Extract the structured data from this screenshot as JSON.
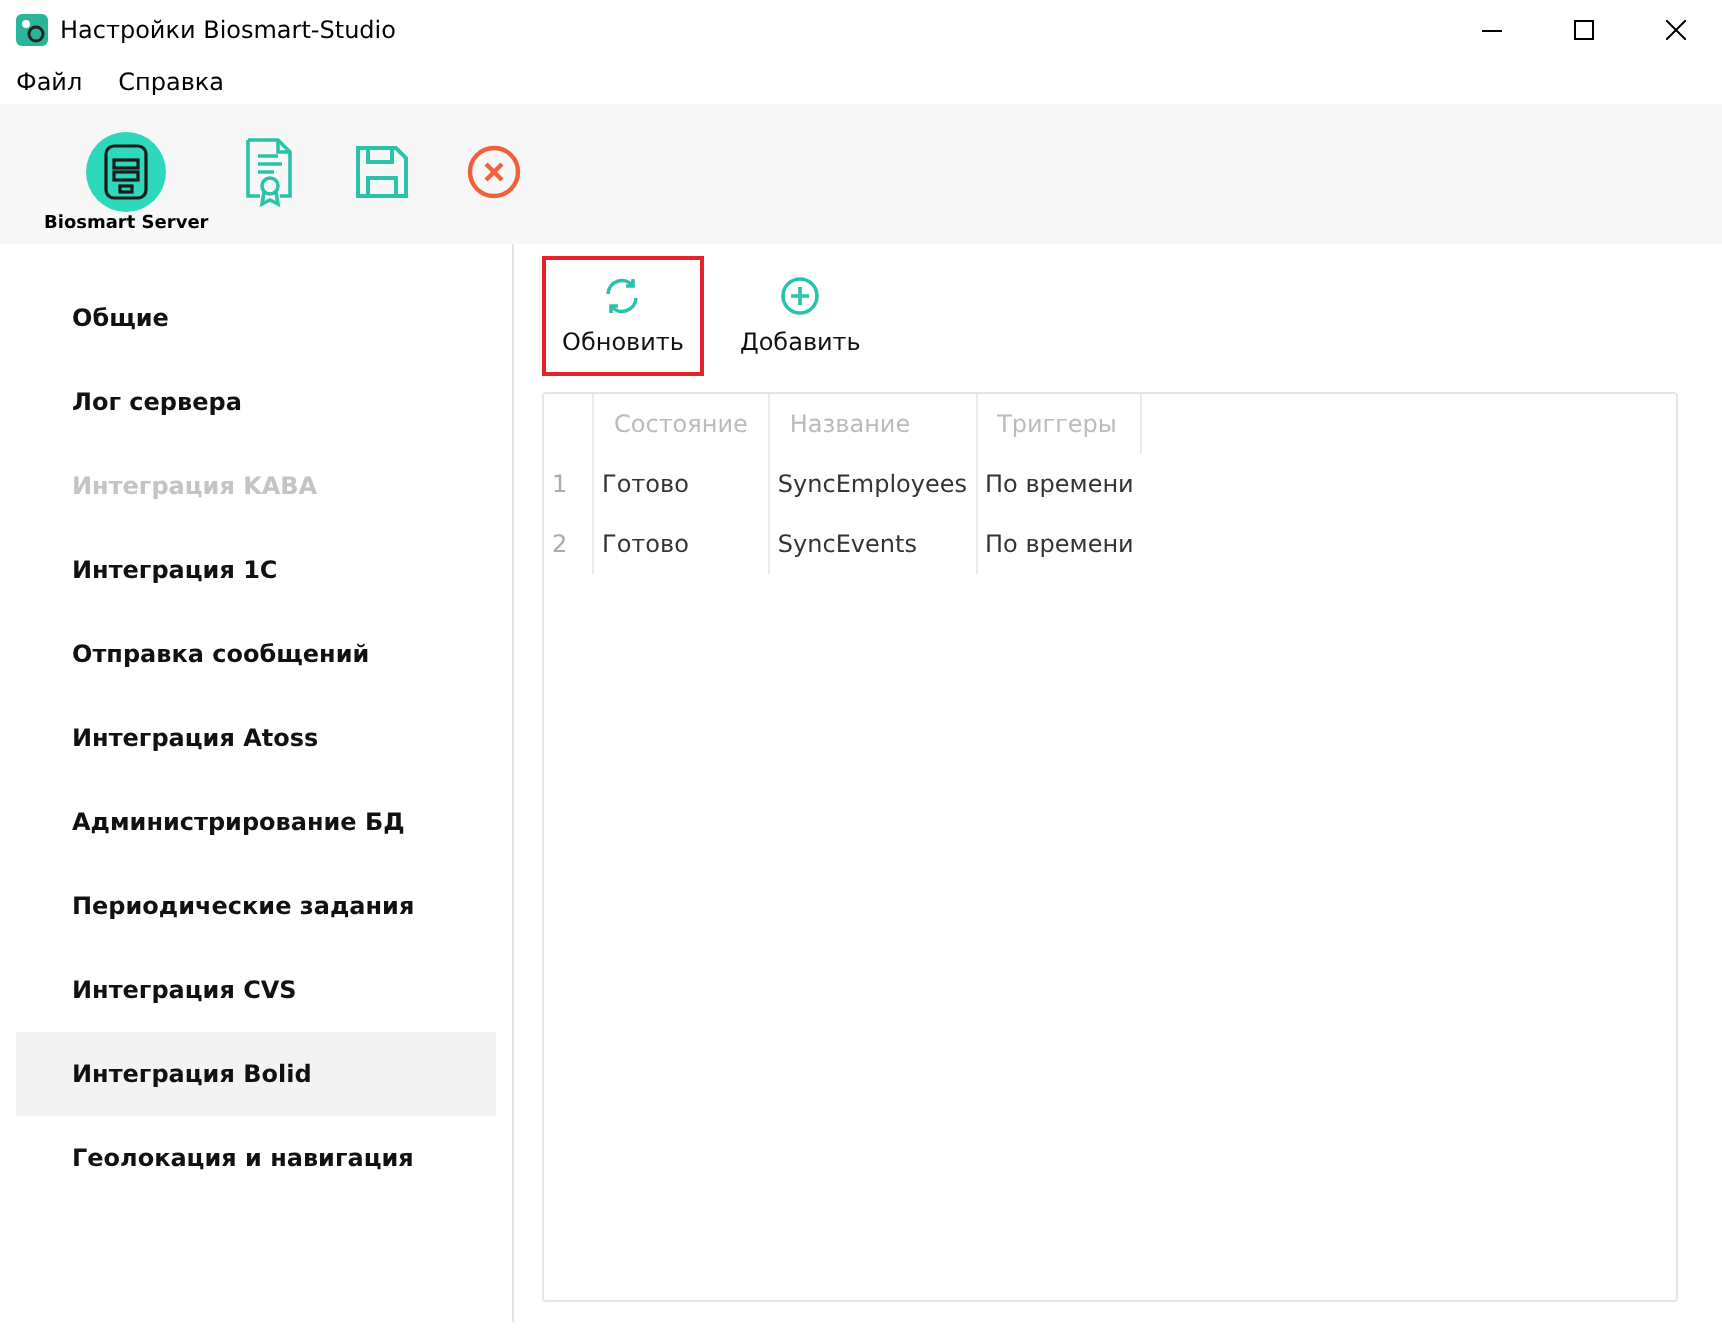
{
  "window": {
    "title": "Настройки Biosmart-Studio"
  },
  "menu": [
    "Файл",
    "Справка"
  ],
  "toolbar": [
    {
      "kind": "server",
      "label": "Biosmart Server",
      "selected": true
    },
    {
      "kind": "certificate",
      "selected": false
    },
    {
      "kind": "save",
      "selected": false
    },
    {
      "kind": "cancel",
      "selected": false
    }
  ],
  "sidebar": {
    "items": [
      {
        "label": "Общие",
        "selected": false,
        "disabled": false
      },
      {
        "label": "Лог сервера",
        "selected": false,
        "disabled": false
      },
      {
        "label": "Интеграция KABA",
        "selected": false,
        "disabled": true
      },
      {
        "label": "Интеграция 1C",
        "selected": false,
        "disabled": false
      },
      {
        "label": "Отправка сообщений",
        "selected": false,
        "disabled": false
      },
      {
        "label": "Интеграция Atoss",
        "selected": false,
        "disabled": false
      },
      {
        "label": "Администрирование БД",
        "selected": false,
        "disabled": false
      },
      {
        "label": "Периодические задания",
        "selected": false,
        "disabled": false
      },
      {
        "label": "Интеграция CVS",
        "selected": false,
        "disabled": false
      },
      {
        "label": "Интеграция Bolid",
        "selected": true,
        "disabled": false
      },
      {
        "label": "Геолокация и навигация",
        "selected": false,
        "disabled": false
      }
    ]
  },
  "actions": [
    {
      "kind": "refresh",
      "label": "Обновить",
      "highlighted": true
    },
    {
      "kind": "add",
      "label": "Добавить",
      "highlighted": false
    }
  ],
  "table": {
    "columns": [
      "Состояние",
      "Название",
      "Триггеры"
    ],
    "rows": [
      {
        "number": "1",
        "cells": [
          "Готово",
          "SyncEmployees",
          "По времени"
        ]
      },
      {
        "number": "2",
        "cells": [
          "Готово",
          "SyncEvents",
          "По времени"
        ]
      }
    ]
  }
}
